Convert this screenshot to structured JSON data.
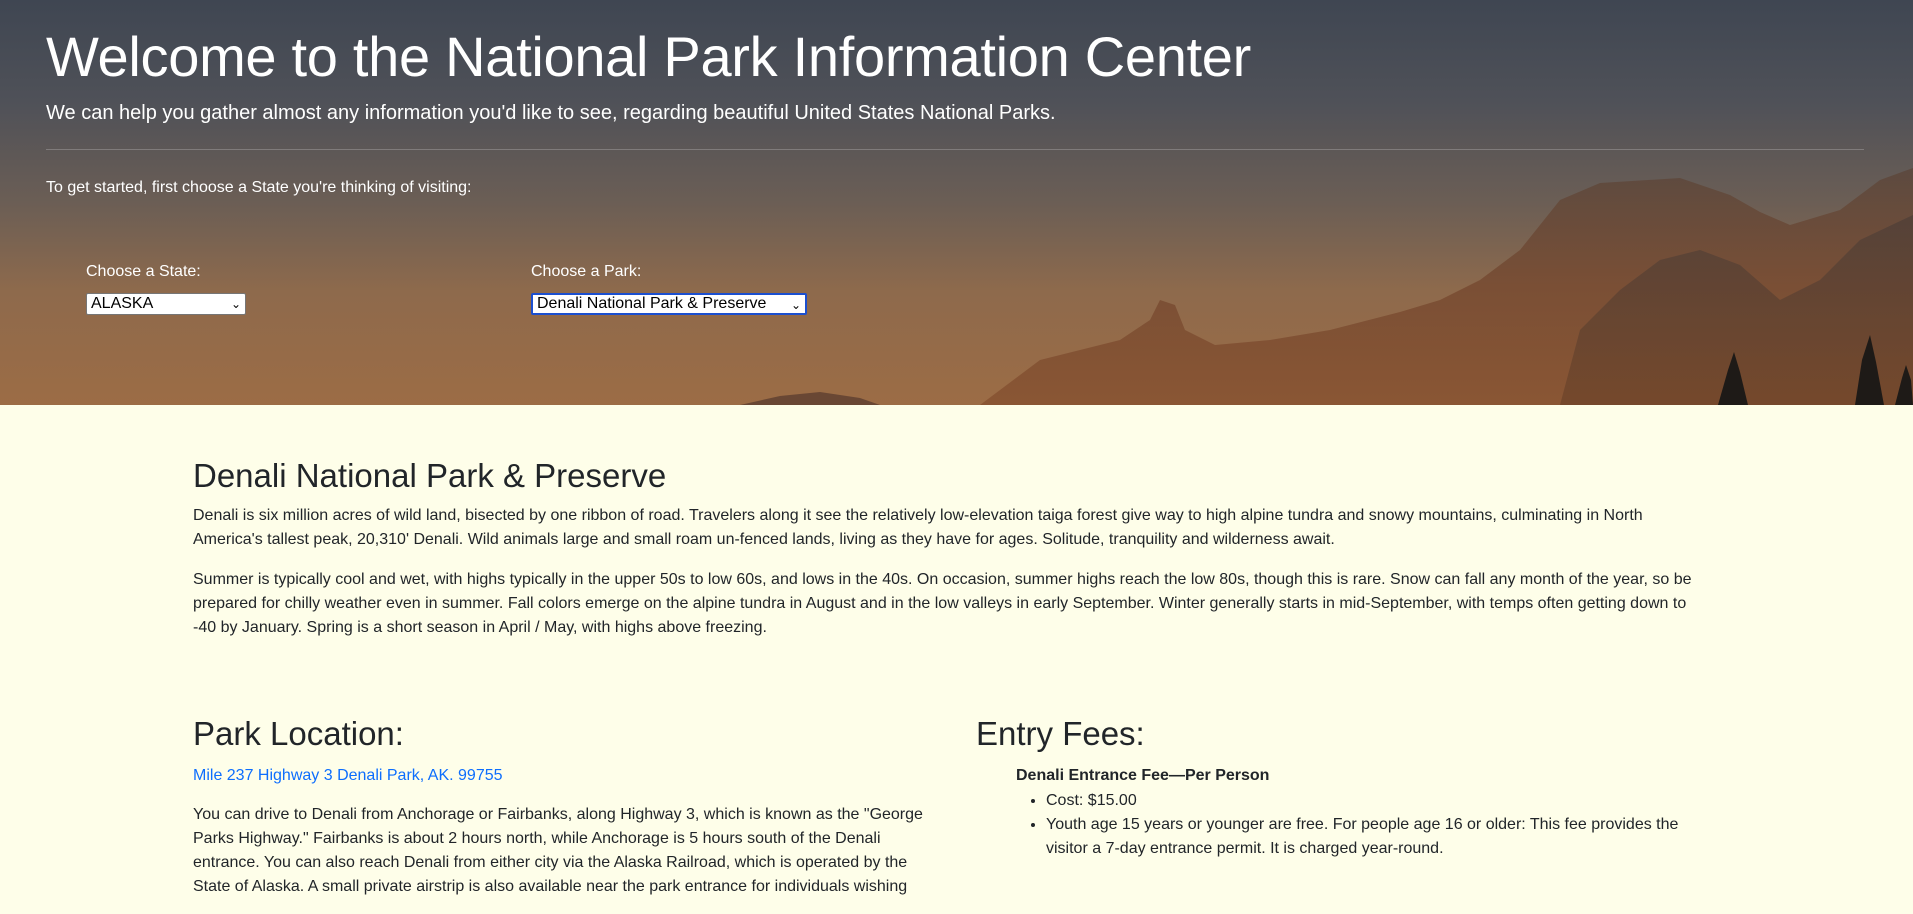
{
  "hero": {
    "title": "Welcome to the National Park Information Center",
    "subtitle": "We can help you gather almost any information you'd like to see, regarding beautiful United States National Parks.",
    "intro": "To get started, first choose a State you're thinking of visiting:",
    "state_label": "Choose a State:",
    "state_value": "ALASKA",
    "park_label": "Choose a Park:",
    "park_value": "Denali National Park & Preserve"
  },
  "park": {
    "name": "Denali National Park & Preserve",
    "description": "Denali is six million acres of wild land, bisected by one ribbon of road. Travelers along it see the relatively low-elevation taiga forest give way to high alpine tundra and snowy mountains, culminating in North America's tallest peak, 20,310' Denali. Wild animals large and small roam un-fenced lands, living as they have for ages. Solitude, tranquility and wilderness await.",
    "weather": "Summer is typically cool and wet, with highs typically in the upper 50s to low 60s, and lows in the 40s. On occasion, summer highs reach the low 80s, though this is rare. Snow can fall any month of the year, so be prepared for chilly weather even in summer. Fall colors emerge on the alpine tundra in August and in the low valleys in early September. Winter generally starts in mid-September, with temps often getting down to -40 by January. Spring is a short season in April / May, with highs above freezing."
  },
  "location": {
    "heading": "Park Location:",
    "address": "Mile 237 Highway 3 Denali Park, AK. 99755",
    "directions": "You can drive to Denali from Anchorage or Fairbanks, along Highway 3, which is known as the \"George Parks Highway.\" Fairbanks is about 2 hours north, while Anchorage is 5 hours south of the Denali entrance. You can also reach Denali from either city via the Alaska Railroad, which is operated by the State of Alaska. A small private airstrip is also available near the park entrance for individuals wishing"
  },
  "fees": {
    "heading": "Entry Fees:",
    "fee_title": "Denali Entrance Fee—Per Person",
    "cost": "Cost: $15.00",
    "details": "Youth age 15 years or younger are free. For people age 16 or older: This fee provides the visitor a 7-day entrance permit. It is charged year-round."
  },
  "colors": {
    "page_background": "#fefee9",
    "link": "#0d6efd",
    "focus_ring": "#1b4fd0"
  },
  "icons": {
    "select_arrow": "chevron-down-icon"
  }
}
